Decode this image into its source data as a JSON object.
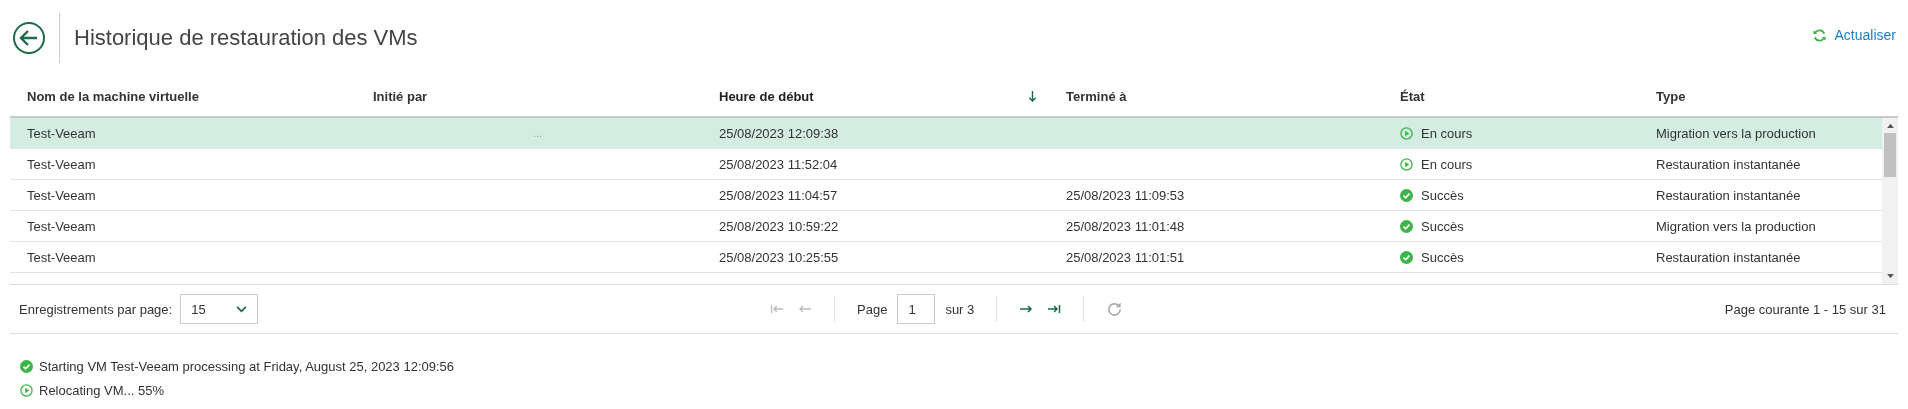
{
  "header": {
    "title": "Historique de restauration des VMs",
    "refresh": "Actualiser"
  },
  "table": {
    "columns": [
      {
        "label": "Nom de la machine virtuelle",
        "sorted": false
      },
      {
        "label": "Initié par",
        "sorted": false
      },
      {
        "label": "Heure de début",
        "sorted": true
      },
      {
        "label": "Terminé à",
        "sorted": false
      },
      {
        "label": "État",
        "sorted": false
      },
      {
        "label": "Type",
        "sorted": false
      }
    ],
    "rows": [
      {
        "name": "Test-Veeam",
        "initiated_by": "...",
        "start": "25/08/2023 12:09:38",
        "end": "",
        "status": "En cours",
        "kind": "running",
        "type": "Migration vers la production",
        "selected": true
      },
      {
        "name": "Test-Veeam",
        "initiated_by": "",
        "start": "25/08/2023 11:52:04",
        "end": "",
        "status": "En cours",
        "kind": "running",
        "type": "Restauration instantanée",
        "selected": false
      },
      {
        "name": "Test-Veeam",
        "initiated_by": "",
        "start": "25/08/2023 11:04:57",
        "end": "25/08/2023 11:09:53",
        "status": "Succès",
        "kind": "success",
        "type": "Restauration instantanée",
        "selected": false
      },
      {
        "name": "Test-Veeam",
        "initiated_by": "",
        "start": "25/08/2023 10:59:22",
        "end": "25/08/2023 11:01:48",
        "status": "Succès",
        "kind": "success",
        "type": "Migration vers la production",
        "selected": false
      },
      {
        "name": "Test-Veeam",
        "initiated_by": "",
        "start": "25/08/2023 10:25:55",
        "end": "25/08/2023 11:01:51",
        "status": "Succès",
        "kind": "success",
        "type": "Restauration instantanée",
        "selected": false
      }
    ]
  },
  "pagination": {
    "per_page_label": "Enregistrements par page:",
    "per_page": "15",
    "page_label": "Page",
    "page": "1",
    "of_pages": "sur 3",
    "first_disabled": true,
    "prev_disabled": true,
    "next_disabled": false,
    "last_disabled": false,
    "summary": "Page courante 1 - 15 sur 31"
  },
  "log": [
    {
      "text": "Starting VM Test-Veeam processing at Friday, August 25, 2023 12:09:56",
      "kind": "success"
    },
    {
      "text": "Relocating VM... 55%",
      "kind": "running"
    }
  ]
}
